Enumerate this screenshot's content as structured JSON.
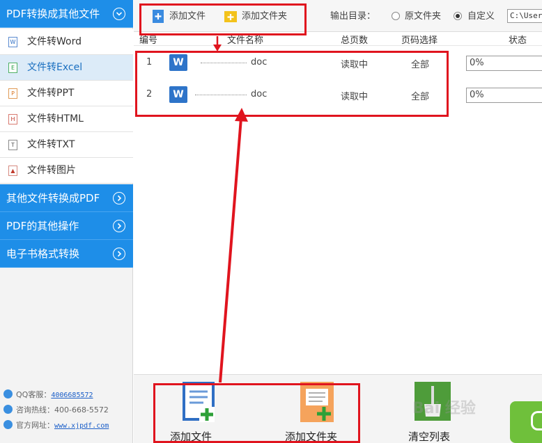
{
  "sidebar": {
    "sections": [
      {
        "label": "PDF转换成其他文件",
        "expanded": true
      },
      {
        "label": "其他文件转换成PDF",
        "expanded": false
      },
      {
        "label": "PDF的其他操作",
        "expanded": false
      },
      {
        "label": "电子书格式转换",
        "expanded": false
      }
    ],
    "items": [
      {
        "label": "文件转Word",
        "icon": "W"
      },
      {
        "label": "文件转Excel",
        "icon": "E",
        "active": true
      },
      {
        "label": "文件转PPT",
        "icon": "P"
      },
      {
        "label": "文件转HTML",
        "icon": "H"
      },
      {
        "label": "文件转TXT",
        "icon": "T"
      },
      {
        "label": "文件转图片",
        "icon": "▲"
      }
    ],
    "contact": {
      "qq_label": "QQ客服：",
      "qq_value": "4006685572",
      "hotline": "咨询热线：400-668-5572",
      "site_label": "官方网址：",
      "site_value": "www.xjpdf.com"
    }
  },
  "toolbar": {
    "add_file": "添加文件",
    "add_folder": "添加文件夹",
    "output_label": "输出目录：",
    "radio_original": "原文件夹",
    "radio_custom": "自定义",
    "path_value": "C:\\Users"
  },
  "table": {
    "headers": {
      "num": "编号",
      "name": "文件名称",
      "pages": "总页数",
      "range": "页码选择",
      "status": "状态"
    },
    "rows": [
      {
        "num": "1",
        "name": "doc",
        "pages": "读取中",
        "range": "全部",
        "progress": "0%"
      },
      {
        "num": "2",
        "name": "doc",
        "pages": "读取中",
        "range": "全部",
        "progress": "0%"
      }
    ]
  },
  "bottom": {
    "add_file": "添加文件",
    "add_folder": "添加文件夹",
    "clear_list": "清空列表",
    "watermark": "Bai 经验"
  },
  "colors": {
    "accent": "#1e8ee8",
    "annotation": "#e0141e",
    "green": "#6fc03b"
  }
}
